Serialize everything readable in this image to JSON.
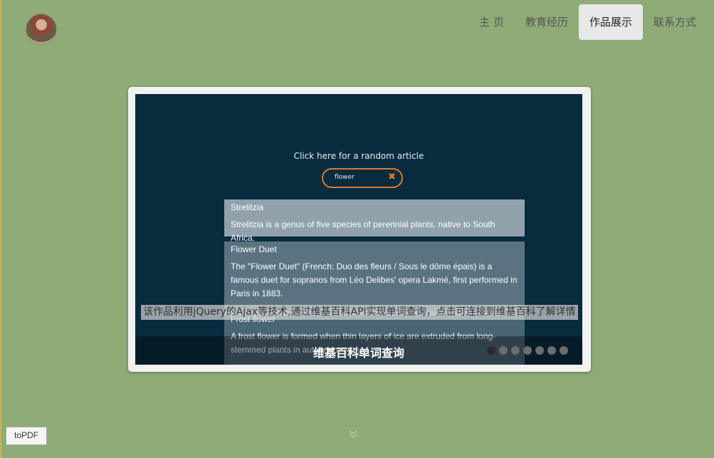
{
  "nav": {
    "items": [
      {
        "label": "主  页",
        "active": false
      },
      {
        "label": "教育经历",
        "active": false
      },
      {
        "label": "作品展示",
        "active": true
      },
      {
        "label": "联系方式",
        "active": false
      }
    ]
  },
  "slide": {
    "random_link": "Click here for a random article",
    "search_value": "flower",
    "clear_icon": "close-icon",
    "results": [
      {
        "title": "Strelitzia",
        "desc": "Strelitzia is a genus of five species of perennial plants, native to South Africa."
      },
      {
        "title": "Flower Duet",
        "desc": "The \"Flower Duet\" (French: Duo des fleurs / Sous le dôme épais) is a famous duet for sopranos from Léo Delibes' opera Lakmé, first performed in Paris in 1883."
      },
      {
        "title": "Frost flower",
        "desc": "A frost flower is formed when thin layers of ice are extruded from long-stemmed plants in autumn or early"
      }
    ],
    "caption": "该作品利用jQuery的Ajax等技术,通过维基百科API实现单词查询，点击可连接到维基百科了解详情",
    "title": "维基百科单词查询",
    "active_dot": 0,
    "dot_count": 7
  },
  "scroll_hint_icon": "double-chevron-down-icon",
  "topdf_label": "toPDF",
  "colors": {
    "background": "#8fab78",
    "slide_bg": "#082b3e",
    "search_border": "#d67a35"
  }
}
